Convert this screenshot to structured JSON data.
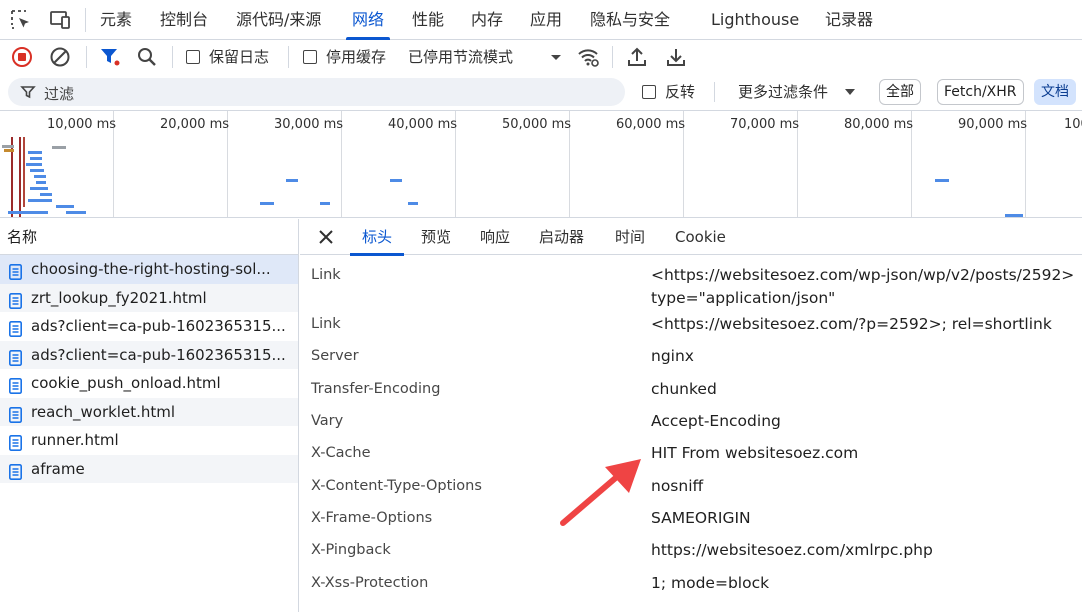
{
  "tabs": {
    "items": [
      "元素",
      "控制台",
      "源代码/来源",
      "网络",
      "性能",
      "内存",
      "应用",
      "隐私与安全",
      "Lighthouse",
      "记录器"
    ],
    "active": "网络"
  },
  "toolbar": {
    "preserve_log_label": "保留日志",
    "disable_cache_label": "停用缓存",
    "throttling_value": "已停用节流模式"
  },
  "filter": {
    "placeholder": "过滤",
    "invert_label": "反转",
    "more_filters_label": "更多过滤条件",
    "type_chips": [
      "全部",
      "Fetch/XHR",
      "文档"
    ],
    "selected_chip": "文档"
  },
  "overview": {
    "tick_labels": [
      "10,000 ms",
      "20,000 ms",
      "30,000 ms",
      "40,000 ms",
      "50,000 ms",
      "60,000 ms",
      "70,000 ms",
      "80,000 ms",
      "90,000 ms",
      "100"
    ]
  },
  "requests": {
    "header": "名称",
    "items": [
      "choosing-the-right-hosting-sol...",
      "zrt_lookup_fy2021.html",
      "ads?client=ca-pub-1602365315...",
      "ads?client=ca-pub-1602365315...",
      "cookie_push_onload.html",
      "reach_worklet.html",
      "runner.html",
      "aframe"
    ],
    "selected_index": 0
  },
  "details": {
    "tabs": [
      "标头",
      "预览",
      "响应",
      "启动器",
      "时间",
      "Cookie"
    ],
    "active_tab": "标头",
    "headers": [
      {
        "name": "Link",
        "value": "<https://websitesoez.com/wp-json/wp/v2/posts/2592>",
        "value2": "type=\"application/json\""
      },
      {
        "name": "Link",
        "value": "<https://websitesoez.com/?p=2592>; rel=shortlink"
      },
      {
        "name": "Server",
        "value": "nginx"
      },
      {
        "name": "Transfer-Encoding",
        "value": "chunked"
      },
      {
        "name": "Vary",
        "value": "Accept-Encoding"
      },
      {
        "name": "X-Cache",
        "value": "HIT From websitesoez.com"
      },
      {
        "name": "X-Content-Type-Options",
        "value": "nosniff"
      },
      {
        "name": "X-Frame-Options",
        "value": "SAMEORIGIN"
      },
      {
        "name": "X-Pingback",
        "value": "https://websitesoez.com/xmlrpc.php"
      },
      {
        "name": "X-Xss-Protection",
        "value": "1; mode=block"
      }
    ]
  },
  "colors": {
    "accent": "#0b57d0",
    "record_red": "#d93025",
    "annotation_arrow": "#ef4444"
  }
}
